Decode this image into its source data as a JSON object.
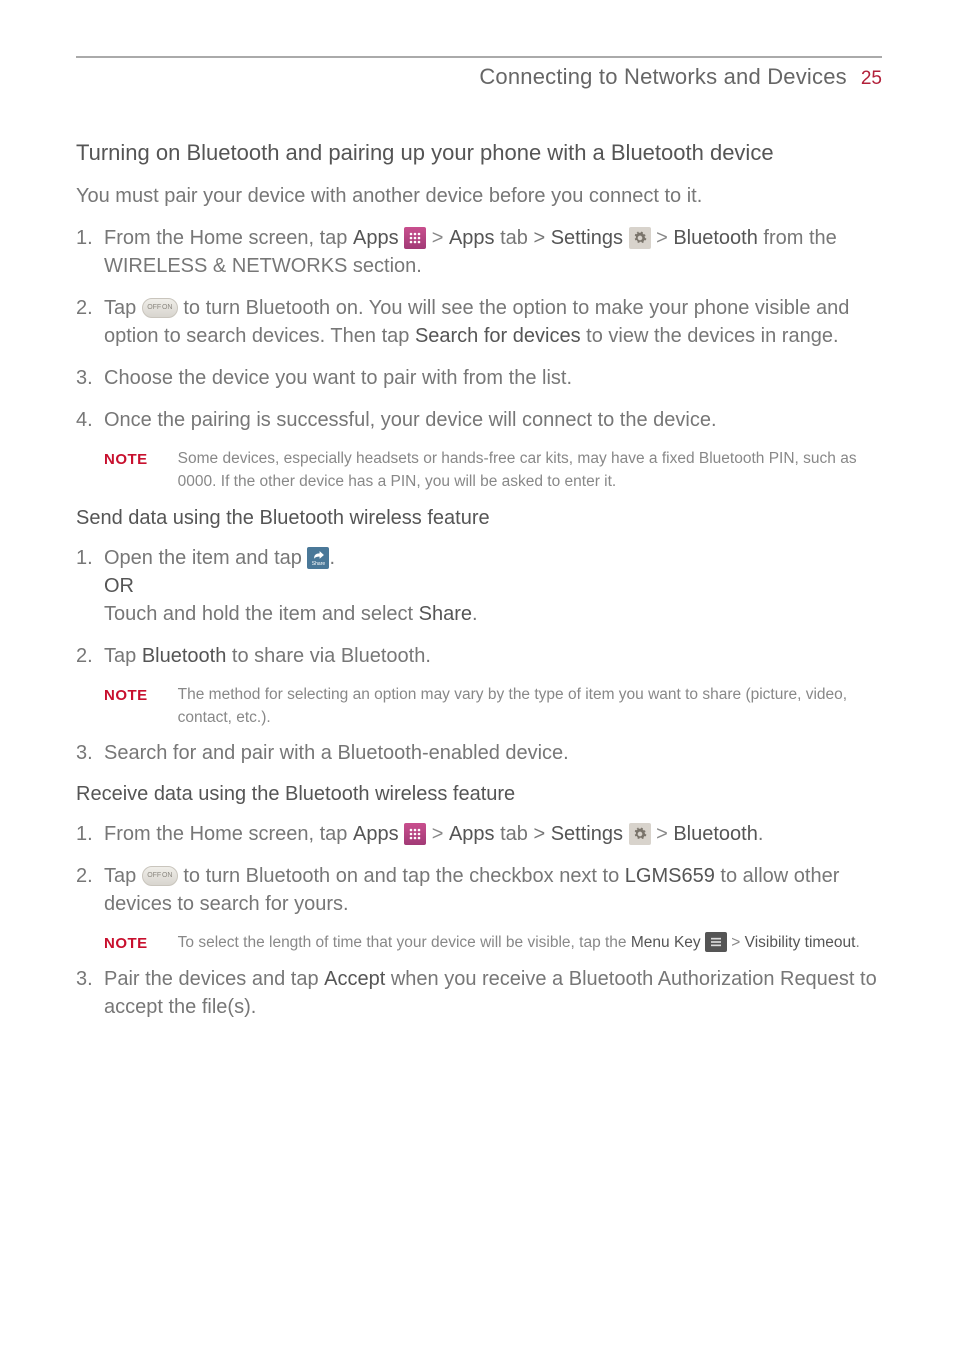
{
  "header": {
    "title": "Connecting to Networks and Devices",
    "page": "25"
  },
  "s1": {
    "heading": "Turning on Bluetooth and pairing up your phone with a Bluetooth device",
    "lead": "You must pair your device with another device before you connect to it.",
    "i1a": "From the Home screen, tap ",
    "i1_apps": "Apps",
    "i1b": " > ",
    "i1_appstab": "Apps",
    "i1c": " tab > ",
    "i1_settings": "Settings",
    "i1d": " > ",
    "i1_bt": "Bluetooth",
    "i1e": " from the WIRELESS & NETWORKS section.",
    "i2a": "Tap ",
    "i2b": " to turn Bluetooth on. You will see the option to make your phone visible and option to search devices. Then tap ",
    "i2_search": "Search for devices",
    "i2c": " to view the devices in range.",
    "i3": "Choose the device you want to pair with from the list.",
    "i4": "Once the pairing is successful, your device will connect to the device.",
    "note_label": "NOTE",
    "note1": "Some devices, especially headsets or hands-free car kits, may have a fixed Bluetooth PIN, such as 0000. If the other device has a PIN, you will be asked to enter it."
  },
  "s2": {
    "heading": "Send data using the Bluetooth wireless feature",
    "i1a": "Open the item and tap ",
    "i1b": ".",
    "i1_or": "OR",
    "i1c": "Touch and hold the item and select ",
    "i1_share": "Share",
    "i1d": ".",
    "i2a": "Tap ",
    "i2_bt": "Bluetooth",
    "i2b": " to share via Bluetooth.",
    "note_label": "NOTE",
    "note1": "The method for selecting an option may vary by the type of item you want to share (picture, video, contact, etc.).",
    "i3": "Search for and pair with a Bluetooth-enabled device."
  },
  "s3": {
    "heading": "Receive data using the Bluetooth wireless feature",
    "i1a": "From the Home screen, tap ",
    "i1_apps": "Apps",
    "i1b": " > ",
    "i1_appstab": "Apps",
    "i1c": " tab > ",
    "i1_settings": "Settings",
    "i1d": " > ",
    "i1_bt": "Bluetooth",
    "i1e": ".",
    "i2a": "Tap ",
    "i2b": " to turn Bluetooth on and tap the checkbox next to ",
    "i2_model": "LGMS659",
    "i2c": " to allow other devices to search for yours.",
    "note_label": "NOTE",
    "note1a": "To select the length of time that your device will be visible, tap the ",
    "note1_menukey": "Menu Key",
    "note1b": " > ",
    "note1_vis": "Visibility timeout",
    "note1c": ".",
    "i3a": "Pair the devices and tap ",
    "i3_accept": "Accept",
    "i3b": " when you receive a Bluetooth Authorization Request to accept the file(s)."
  }
}
